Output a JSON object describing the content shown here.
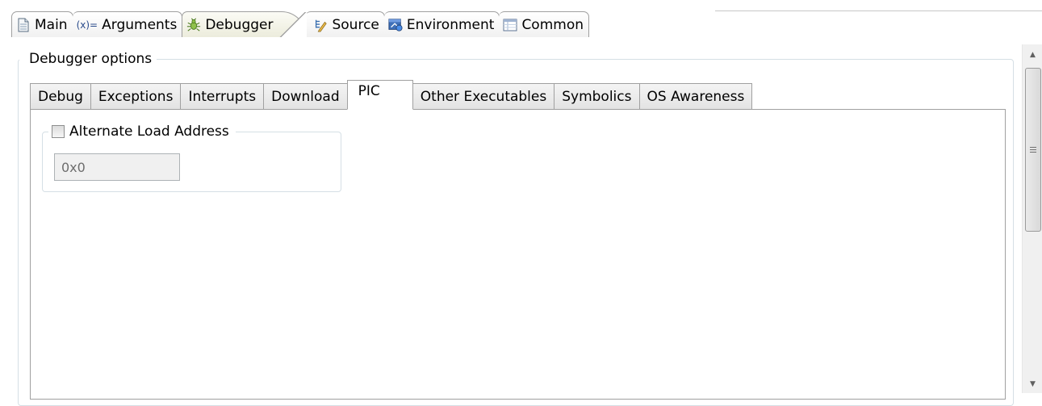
{
  "top_tabs": [
    {
      "label": "Main",
      "icon": "document-icon"
    },
    {
      "label": "Arguments",
      "icon_text": "(x)=",
      "icon": "arguments-icon"
    },
    {
      "label": "Debugger",
      "icon": "bug-icon",
      "selected": true
    },
    {
      "label": "Source",
      "icon": "source-icon"
    },
    {
      "label": "Environment",
      "icon": "environment-icon"
    },
    {
      "label": "Common",
      "icon": "common-icon"
    }
  ],
  "group": {
    "title": "Debugger options"
  },
  "inner_tabs": [
    {
      "label": "Debug"
    },
    {
      "label": "Exceptions"
    },
    {
      "label": "Interrupts"
    },
    {
      "label": "Download"
    },
    {
      "label": "PIC",
      "selected": true
    },
    {
      "label": "Other Executables"
    },
    {
      "label": "Symbolics"
    },
    {
      "label": "OS Awareness"
    }
  ],
  "alternate_load": {
    "checkbox_label": "Alternate Load Address",
    "checked": false,
    "address_value": "0x0"
  },
  "colors": {
    "border": "#a0a0a0",
    "group_border": "#d5dfe5",
    "disabled_input_bg": "#f0f0f0"
  }
}
